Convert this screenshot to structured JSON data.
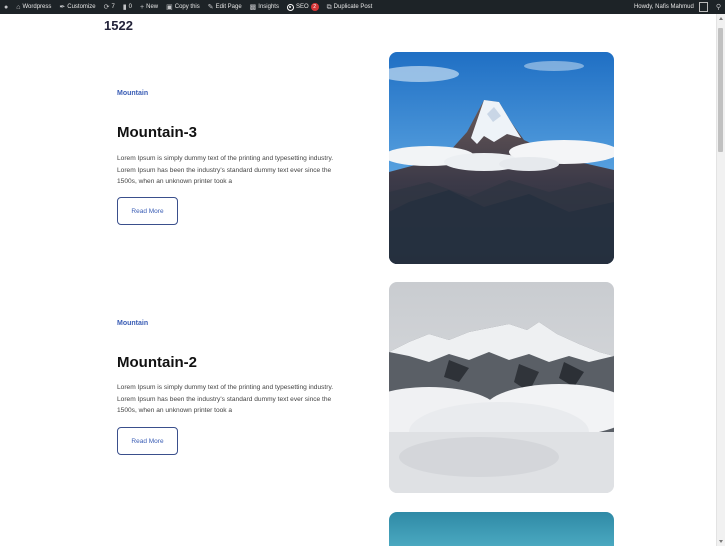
{
  "adminbar": {
    "wp_logo": "wordpress-logo-icon",
    "site_name": "Wordpress",
    "customize": "Customize",
    "updates_count": "7",
    "comments_count": "0",
    "new": "New",
    "copy": "Copy this",
    "edit": "Edit Page",
    "insights": "Insights",
    "seo": "SEO",
    "seo_badge": "2",
    "duplicate": "Duplicate Post",
    "howdy": "Howdy, Nafis Mahmud"
  },
  "page": {
    "heading": "1522"
  },
  "posts": [
    {
      "category": "Mountain",
      "title": "Mountain-3",
      "excerpt_lines": [
        "Lorem Ipsum is simply dummy text of the printing and typesetting industry.",
        "Lorem Ipsum has been the industry's standard dummy text ever since the",
        "1500s, when an unknown printer took a"
      ],
      "button": "Read More"
    },
    {
      "category": "Mountain",
      "title": "Mountain-2",
      "excerpt_lines": [
        "Lorem Ipsum is simply dummy text of the printing and typesetting industry.",
        "Lorem Ipsum has been the industry's standard dummy text ever since the",
        "1500s, when an unknown printer took a"
      ],
      "button": "Read More"
    }
  ],
  "colors": {
    "adminbar_bg": "#1d2327",
    "category": "#3a5db5",
    "button_border": "#3a4f8c"
  }
}
